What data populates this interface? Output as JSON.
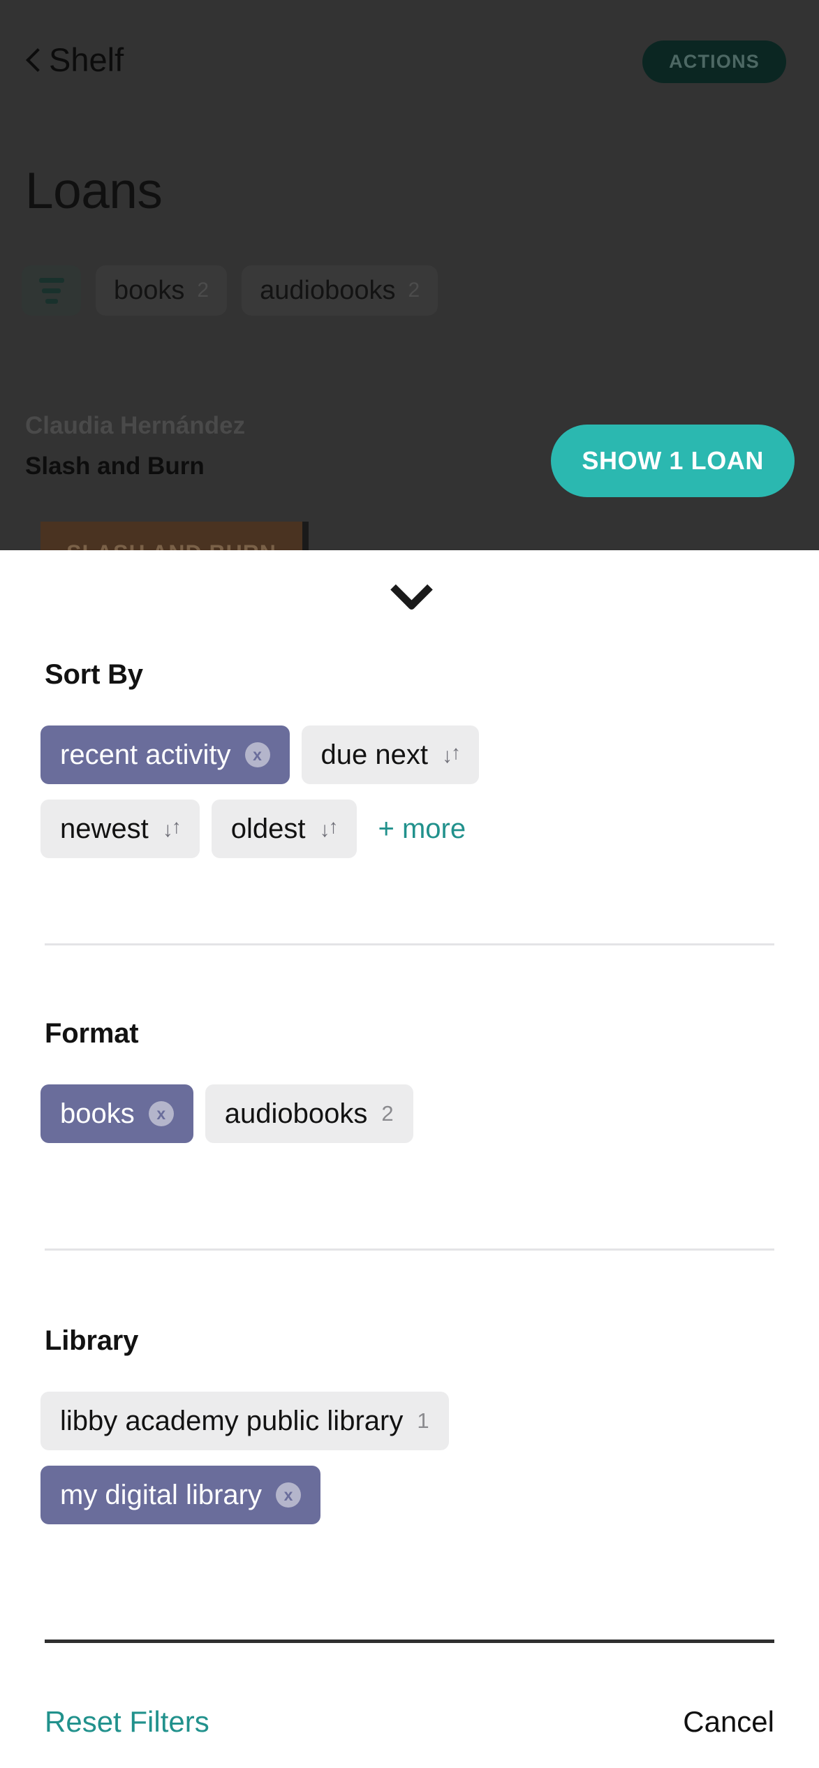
{
  "background": {
    "back_label": "Shelf",
    "back_icon": "chevron-left-icon",
    "actions_label": "ACTIONS",
    "page_title": "Loans",
    "filter_icon": "sort-lines-icon",
    "tabs": [
      {
        "label": "books",
        "count": "2"
      },
      {
        "label": "audiobooks",
        "count": "2"
      }
    ],
    "loan": {
      "author": "Claudia Hernández",
      "title": "Slash and Burn",
      "cover_text": "SLASH AND BURN",
      "show_button": "SHOW 1 LOAN"
    }
  },
  "sheet": {
    "handle_icon": "chevron-down-icon",
    "sections": [
      {
        "title": "Sort By",
        "chips": [
          {
            "label": "recent activity",
            "selected": true,
            "badge": "x",
            "icon": "close-circle-icon"
          },
          {
            "label": "due next",
            "selected": false,
            "badge": "",
            "icon": "sort-updown-icon"
          },
          {
            "label": "newest",
            "selected": false,
            "badge": "",
            "icon": "sort-updown-icon"
          },
          {
            "label": "oldest",
            "selected": false,
            "badge": "",
            "icon": "sort-updown-icon"
          }
        ],
        "more_label": "+ more"
      },
      {
        "title": "Format",
        "chips": [
          {
            "label": "books",
            "selected": true,
            "badge": "x",
            "icon": "close-circle-icon"
          },
          {
            "label": "audiobooks",
            "selected": false,
            "count": "2"
          }
        ]
      },
      {
        "title": "Library",
        "chips": [
          {
            "label": "libby academy public library",
            "selected": false,
            "count": "1"
          },
          {
            "label": "my digital library",
            "selected": true,
            "badge": "x",
            "icon": "close-circle-icon"
          }
        ]
      }
    ],
    "footer": {
      "reset_label": "Reset Filters",
      "cancel_label": "Cancel"
    }
  },
  "colors": {
    "accent_teal": "#21918c",
    "selected_purple": "#6a6d9b",
    "chip_grey": "#ececed",
    "primary_button": "#2bb8b0",
    "scrim": "#333333"
  }
}
